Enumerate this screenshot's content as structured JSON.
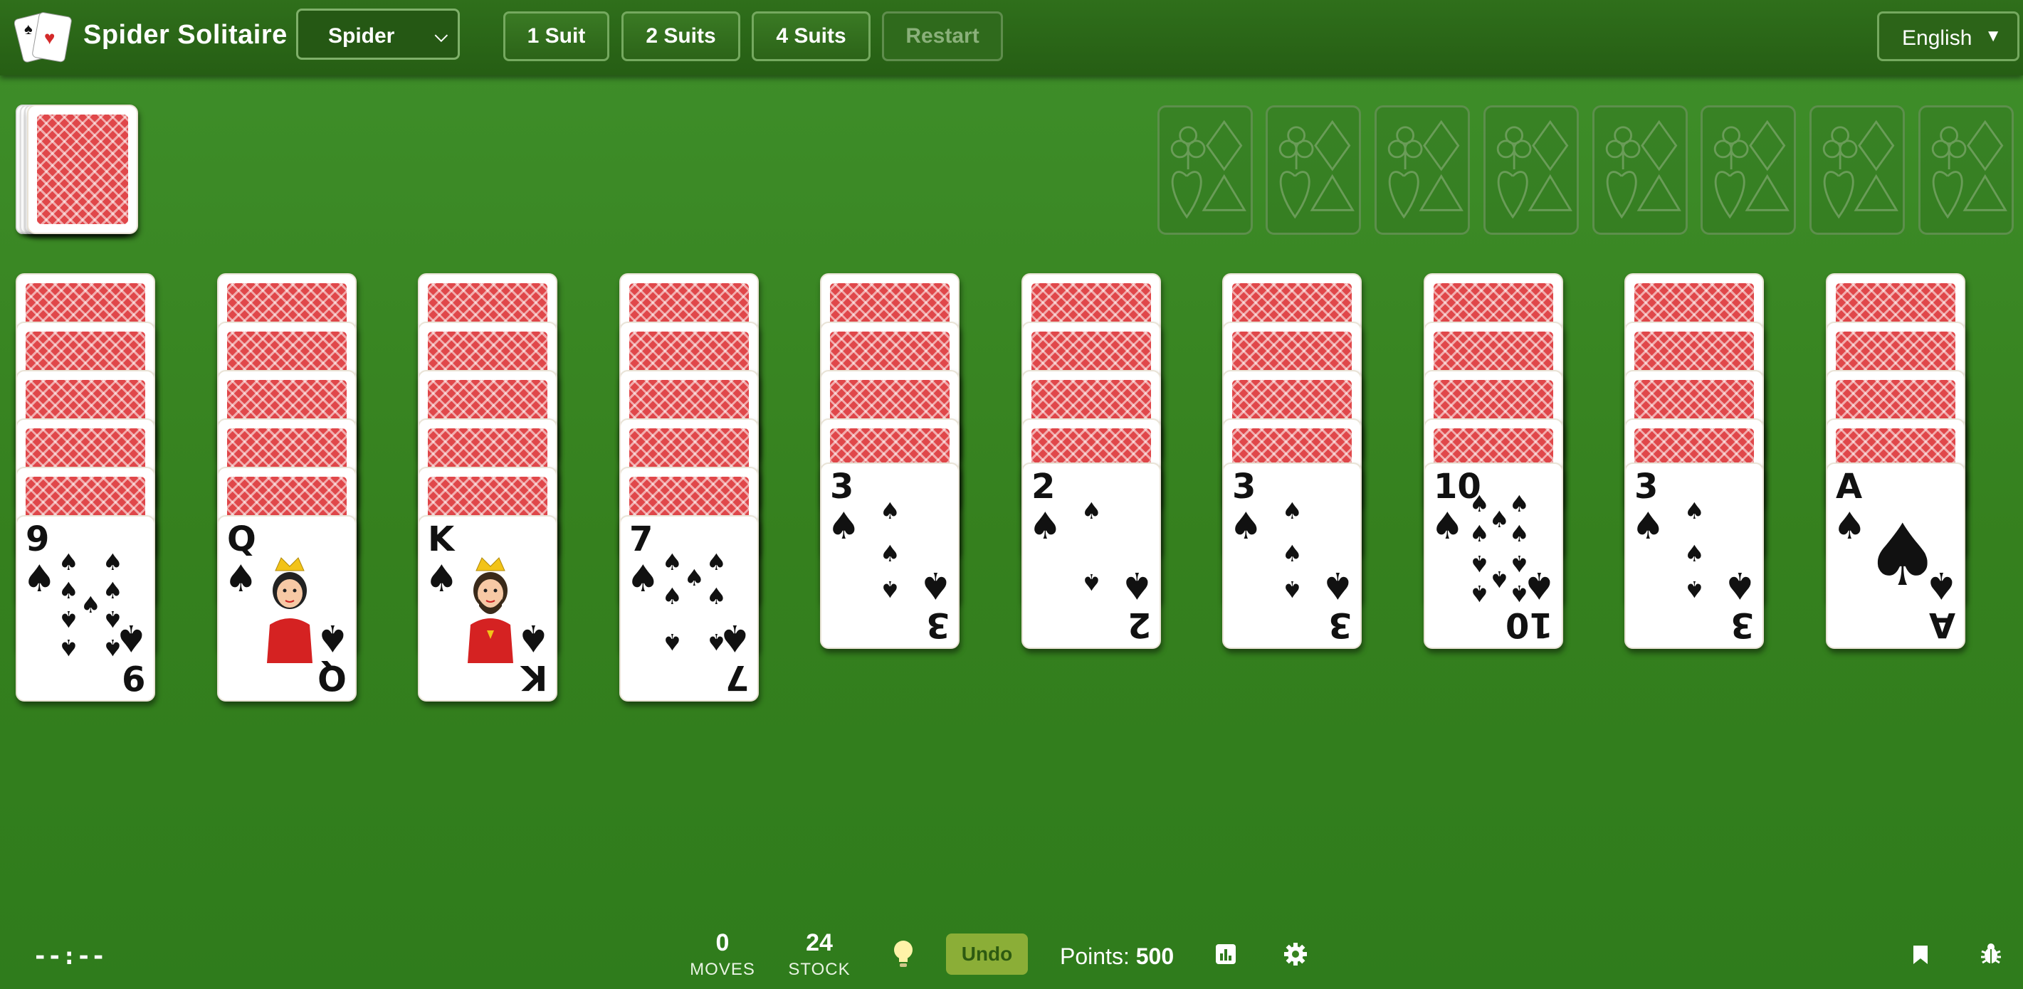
{
  "header": {
    "app_title": "Spider Solitaire",
    "game_select": "Spider",
    "buttons": [
      "1 Suit",
      "2 Suits",
      "4 Suits",
      "Restart"
    ],
    "language": "English"
  },
  "stock": {
    "count": 24
  },
  "foundations": {
    "slots": 8,
    "filled": 0
  },
  "tableau": [
    {
      "face_down": 5,
      "face_up": [
        {
          "rank": "9",
          "suit": "♠"
        }
      ]
    },
    {
      "face_down": 5,
      "face_up": [
        {
          "rank": "Q",
          "suit": "♠"
        }
      ]
    },
    {
      "face_down": 5,
      "face_up": [
        {
          "rank": "K",
          "suit": "♠"
        }
      ]
    },
    {
      "face_down": 5,
      "face_up": [
        {
          "rank": "7",
          "suit": "♠"
        }
      ]
    },
    {
      "face_down": 4,
      "face_up": [
        {
          "rank": "3",
          "suit": "♠"
        }
      ]
    },
    {
      "face_down": 4,
      "face_up": [
        {
          "rank": "2",
          "suit": "♠"
        }
      ]
    },
    {
      "face_down": 4,
      "face_up": [
        {
          "rank": "3",
          "suit": "♠"
        }
      ]
    },
    {
      "face_down": 4,
      "face_up": [
        {
          "rank": "10",
          "suit": "♠"
        }
      ]
    },
    {
      "face_down": 4,
      "face_up": [
        {
          "rank": "3",
          "suit": "♠"
        }
      ]
    },
    {
      "face_down": 4,
      "face_up": [
        {
          "rank": "A",
          "suit": "♠"
        }
      ]
    }
  ],
  "status": {
    "timer": "--:--",
    "moves_value": "0",
    "moves_label": "MOVES",
    "stock_value": "24",
    "stock_label": "STOCK",
    "undo_label": "Undo",
    "points_label": "Points:",
    "points_value": "500"
  },
  "colors": {
    "felt": "#37831f",
    "header": "#2a6617",
    "undo": "#8bae37",
    "card_back": "#e0474a"
  },
  "icons": [
    "hint-lightbulb-icon",
    "statistics-icon",
    "settings-gear-icon",
    "bookmark-icon",
    "bug-report-icon"
  ]
}
